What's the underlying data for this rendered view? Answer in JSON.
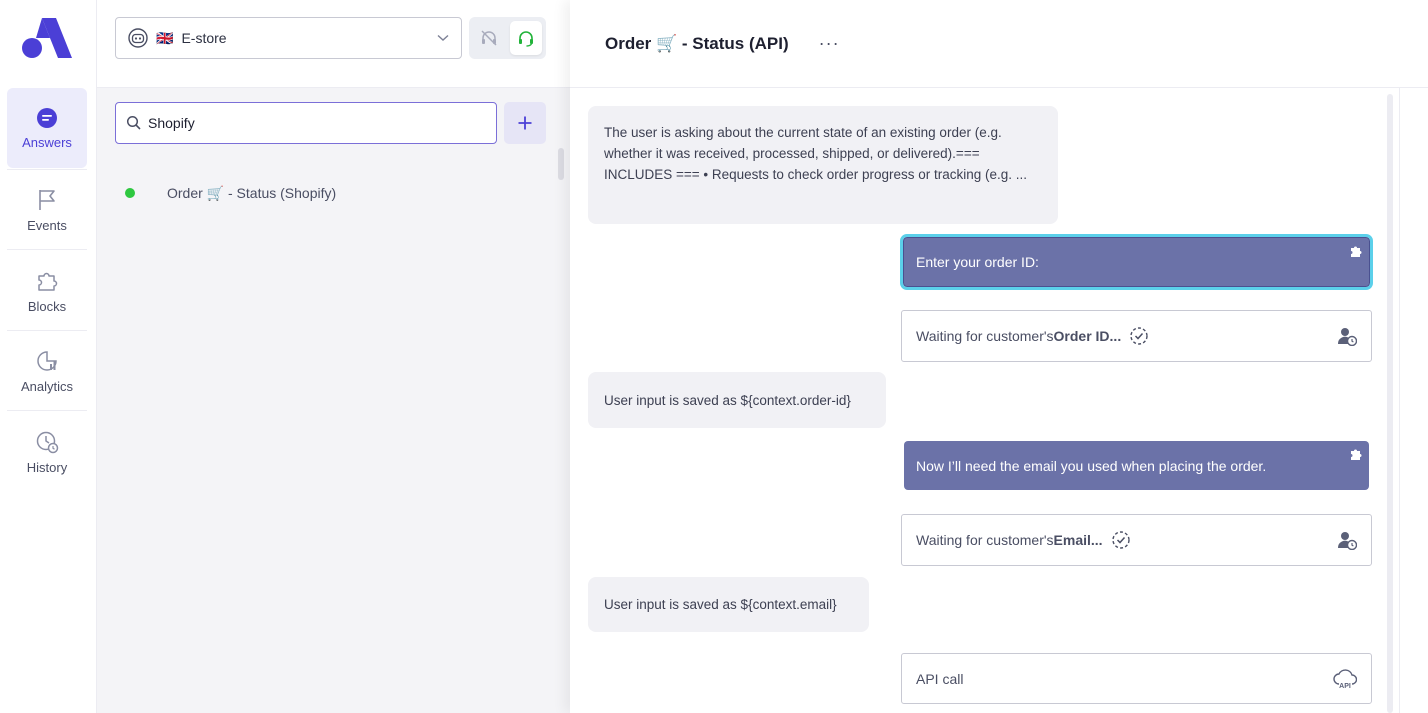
{
  "nav": {
    "items": [
      {
        "label": "Answers",
        "icon": "chat-bubble-icon",
        "active": true
      },
      {
        "label": "Events",
        "icon": "flag-icon"
      },
      {
        "label": "Blocks",
        "icon": "puzzle-icon"
      },
      {
        "label": "Analytics",
        "icon": "analytics-icon"
      },
      {
        "label": "History",
        "icon": "history-icon"
      }
    ]
  },
  "store": {
    "flag": "🇬🇧",
    "name": "E-store"
  },
  "search": {
    "value": "Shopify"
  },
  "answers_list": [
    {
      "title": "Order 🛒 - Status (Shopify)",
      "status_color": "#2ec840"
    }
  ],
  "detail": {
    "title": "Order 🛒 - Status (API)",
    "more": "···",
    "flow": {
      "intent": "The user is asking about the current state of an existing order (e.g. whether it was received, processed, shipped, or delivered).=== INCLUDES === • Requests to check order progress or tracking (e.g. ...",
      "msg1": "Enter your order ID:",
      "wait1_prefix": "Waiting for customer's ",
      "wait1_var": "Order ID...",
      "saved1": "User input is saved as ${context.order-id}",
      "msg2": "Now I’ll need the email you used when placing the order.",
      "wait2_prefix": "Waiting for customer's ",
      "wait2_var": "Email...",
      "saved2": "User input is saved as ${context.email}",
      "api": "API call"
    }
  },
  "colors": {
    "accent": "#4b3fd6",
    "bot_bubble": "#6b72a8",
    "selected_outline": "#5bd0ea",
    "online": "#2ec840"
  }
}
